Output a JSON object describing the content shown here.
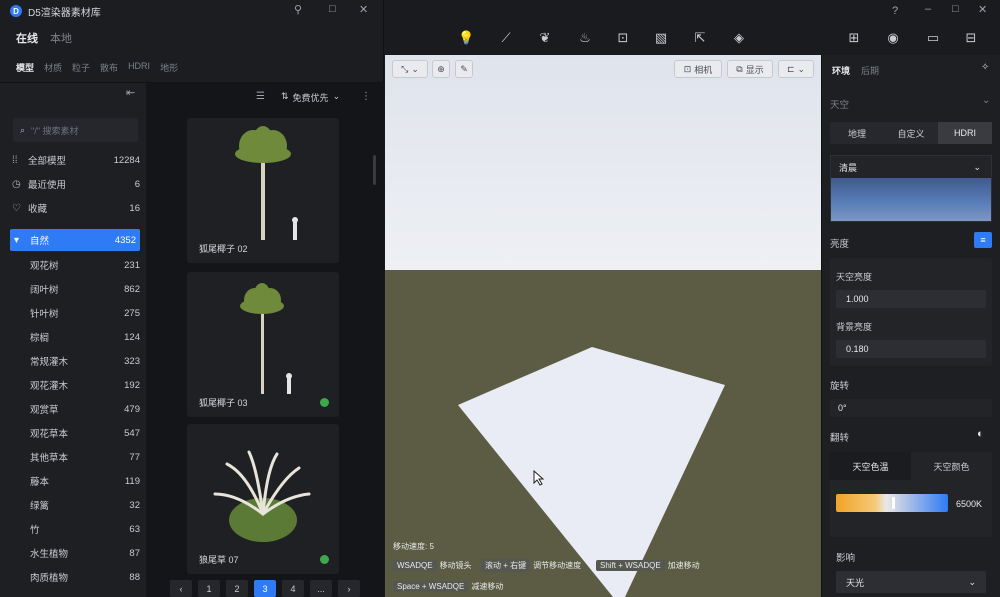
{
  "library": {
    "title": "D5渲染器素材库",
    "source_tabs": [
      "在线",
      "本地"
    ],
    "category_tabs": [
      "模型",
      "材质",
      "粒子",
      "散布",
      "HDRI",
      "地形"
    ],
    "search_placeholder": "\"/\" 搜索素材",
    "sort_label": "免费优先",
    "sidebar": [
      {
        "label": "全部模型",
        "count": "12284",
        "icon": "grid-icon"
      },
      {
        "label": "最近使用",
        "count": "6",
        "icon": "history-icon"
      },
      {
        "label": "收藏",
        "count": "16",
        "icon": "heart-icon"
      },
      {
        "label": "自然",
        "count": "4352",
        "active": true
      },
      {
        "label": "观花树",
        "count": "231"
      },
      {
        "label": "阔叶树",
        "count": "862"
      },
      {
        "label": "针叶树",
        "count": "275"
      },
      {
        "label": "棕榈",
        "count": "124"
      },
      {
        "label": "常规灌木",
        "count": "323"
      },
      {
        "label": "观花灌木",
        "count": "192"
      },
      {
        "label": "观赏草",
        "count": "479"
      },
      {
        "label": "观花草本",
        "count": "547"
      },
      {
        "label": "其他草本",
        "count": "77"
      },
      {
        "label": "藤本",
        "count": "119"
      },
      {
        "label": "绿篱",
        "count": "32"
      },
      {
        "label": "竹",
        "count": "63"
      },
      {
        "label": "水生植物",
        "count": "87"
      },
      {
        "label": "肉质植物",
        "count": "88"
      }
    ],
    "cards": [
      {
        "name": "狐尾椰子 02",
        "downloaded": false
      },
      {
        "name": "狐尾椰子 03",
        "downloaded": true
      },
      {
        "name": "狼尾草 07",
        "downloaded": true
      }
    ],
    "pager": [
      "‹",
      "1",
      "2",
      "3",
      "4",
      "...",
      "›"
    ],
    "current_page": "3"
  },
  "viewport": {
    "camera_label": "相机",
    "display_label": "显示",
    "speed_text": "移动速度: 5",
    "hints": [
      {
        "key": "WSADQE",
        "desc": "移动镜头"
      },
      {
        "key": "滚动 + 右键",
        "desc": "调节移动速度"
      },
      {
        "key": "Shift + WSADQE",
        "desc": "加速移动"
      },
      {
        "key": "Space + WSADQE",
        "desc": "减速移动"
      }
    ]
  },
  "panel": {
    "tabs": [
      "环境",
      "后期"
    ],
    "sky_header": "天空",
    "sky_modes": [
      "地理",
      "自定义",
      "HDRI"
    ],
    "hdri_selected": "清晨",
    "brightness_header": "亮度",
    "sky_brightness_label": "天空亮度",
    "sky_brightness_value": "1.000",
    "bg_brightness_label": "背景亮度",
    "bg_brightness_value": "0.180",
    "rotation_header": "旋转",
    "rotation_value": "0°",
    "flip_header": "翻转",
    "color_modes": [
      "天空色温",
      "天空颜色"
    ],
    "temperature_value": "6500K",
    "temperature_fraction": 0.5,
    "influence_header": "影响",
    "influence_value": "天光"
  },
  "colors": {
    "accent": "#2f7bf5",
    "panel": "#1e1f23",
    "sky": "#e6e9f0",
    "ground": "#5b5c43"
  }
}
